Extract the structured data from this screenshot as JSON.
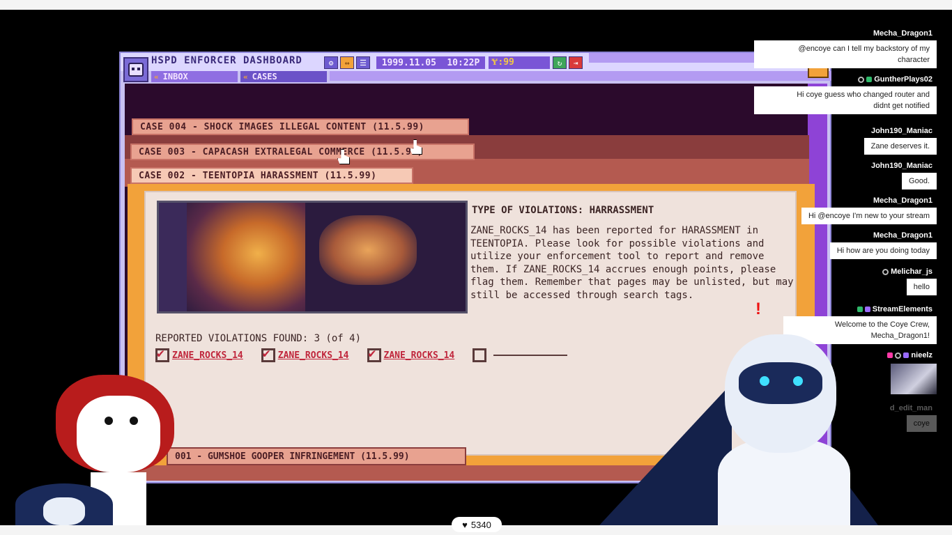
{
  "app": {
    "title": "HSPD ENFORCER DASHBOARD",
    "date": "1999.11.05",
    "time": "10:22P",
    "coins": "Ɏ:99",
    "nav": [
      {
        "label": "INBOX",
        "chev": "«"
      },
      {
        "label": "CASES",
        "chev": "«"
      }
    ]
  },
  "cases": {
    "tab4": "CASE 004 - SHOCK IMAGES ILLEGAL CONTENT (11.5.99)",
    "tab3": "CASE 003 - CAPACASH EXTRALEGAL COMMERCE (11.5.99)",
    "tab2": "CASE 002 - TEENTOPIA HARASSMENT (11.5.99)",
    "tab1": "001 - GUMSHOE GOOPER INFRINGEMENT (11.5.99)"
  },
  "case_detail": {
    "violation_type": "TYPE OF VIOLATIONS: HARRASSMENT",
    "description": "ZANE_ROCKS_14 has been reported for HARASSMENT in TEENTOPIA. Please look for possible violations and utilize your enforcement tool to report and remove them. If ZANE_ROCKS_14 accrues enough points, please flag them. Remember that pages may be unlisted, but may still be accessed through search tags.",
    "found_label": "REPORTED VIOLATIONS FOUND: 3 (of 4)",
    "violations": [
      {
        "label": "ZANE_ROCKS_14",
        "checked": true
      },
      {
        "label": "ZANE_ROCKS_14",
        "checked": true
      },
      {
        "label": "ZANE_ROCKS_14",
        "checked": true
      },
      {
        "label": "",
        "checked": false
      }
    ]
  },
  "chat": {
    "messages": [
      {
        "user": "Mecha_Dragon1",
        "text1": "@encoye can I tell my backstory of my",
        "text2": "character"
      },
      {
        "user": "GuntherPlays02",
        "text1": "Hi coye guess who changed router and",
        "text2": "didnt get notified"
      },
      {
        "user": "John190_Maniac",
        "text1": "Zane deserves it."
      },
      {
        "user": "John190_Maniac",
        "text1": "Good."
      },
      {
        "user": "Mecha_Dragon1",
        "text1": "Hi @encoye I'm new to your stream"
      },
      {
        "user": "Mecha_Dragon1",
        "text1": "Hi how are you doing today"
      },
      {
        "user": "Melichar_js",
        "text1": "hello"
      },
      {
        "user": "StreamElements",
        "text1": "Welcome to the Coye Crew,",
        "text2": "Mecha_Dragon1!"
      },
      {
        "user": "nieelz"
      },
      {
        "user": "d_edit_man",
        "text1": "coye"
      }
    ]
  },
  "stream": {
    "hearts": "5340"
  },
  "icons": {
    "settings": "gear-icon",
    "arrows": "swap-icon",
    "menu": "menu-icon",
    "refresh": "refresh-icon",
    "logout": "logout-icon",
    "heart": "heart-icon"
  }
}
